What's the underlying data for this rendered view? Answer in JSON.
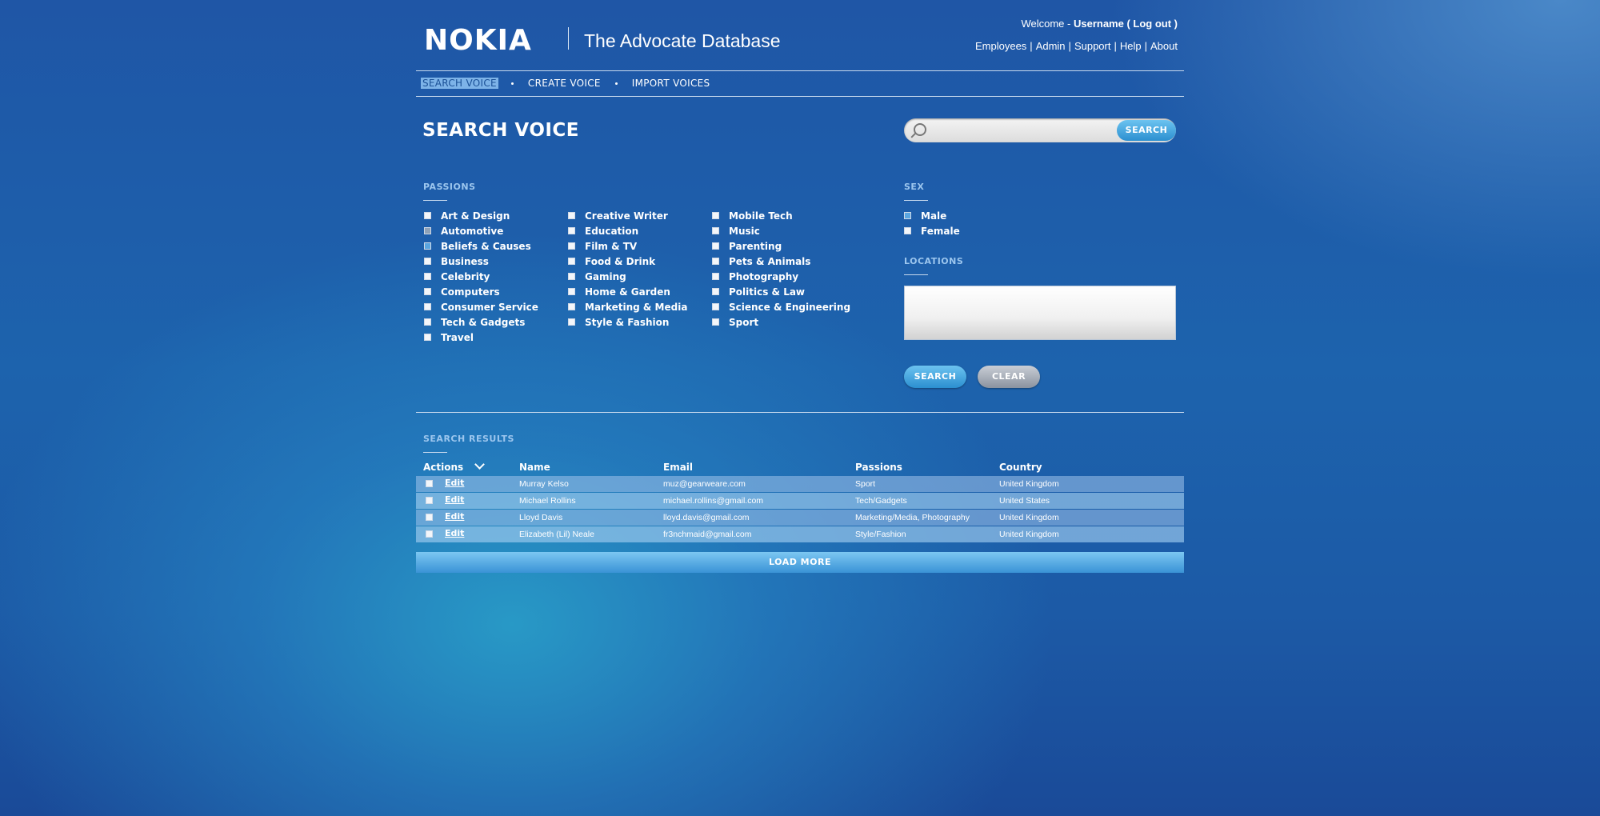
{
  "header": {
    "logo_text": "NOKIA",
    "app_title": "The Advocate Database",
    "welcome_prefix": "Welcome - ",
    "username": "Username",
    "logout": "( Log out )",
    "links": [
      "Employees",
      "Admin",
      "Support",
      "Help",
      "About"
    ]
  },
  "nav": {
    "items": [
      "SEARCH VOICE",
      "CREATE VOICE",
      "IMPORT VOICES"
    ],
    "active_index": 0
  },
  "page_title": "SEARCH VOICE",
  "search": {
    "placeholder": "",
    "button_label": "SEARCH"
  },
  "passions": {
    "label": "PASSIONS",
    "columns": [
      [
        {
          "label": "Art & Design",
          "state": "unchecked"
        },
        {
          "label": "Automotive",
          "state": "mid"
        },
        {
          "label": "Beliefs & Causes",
          "state": "checked"
        },
        {
          "label": "Business",
          "state": "unchecked"
        },
        {
          "label": "Celebrity",
          "state": "unchecked"
        },
        {
          "label": "Computers",
          "state": "unchecked"
        },
        {
          "label": "Consumer Service",
          "state": "unchecked"
        },
        {
          "label": "Tech & Gadgets",
          "state": "unchecked"
        },
        {
          "label": "Travel",
          "state": "unchecked"
        }
      ],
      [
        {
          "label": "Creative Writer",
          "state": "unchecked"
        },
        {
          "label": "Education",
          "state": "unchecked"
        },
        {
          "label": "Film & TV",
          "state": "unchecked"
        },
        {
          "label": "Food & Drink",
          "state": "unchecked"
        },
        {
          "label": "Gaming",
          "state": "unchecked"
        },
        {
          "label": "Home & Garden",
          "state": "unchecked"
        },
        {
          "label": "Marketing & Media",
          "state": "unchecked"
        },
        {
          "label": "Style & Fashion",
          "state": "unchecked"
        }
      ],
      [
        {
          "label": "Mobile Tech",
          "state": "unchecked"
        },
        {
          "label": "Music",
          "state": "unchecked"
        },
        {
          "label": "Parenting",
          "state": "unchecked"
        },
        {
          "label": "Pets & Animals",
          "state": "unchecked"
        },
        {
          "label": "Photography",
          "state": "unchecked"
        },
        {
          "label": "Politics & Law",
          "state": "unchecked"
        },
        {
          "label": "Science & Engineering",
          "state": "unchecked"
        },
        {
          "label": "Sport",
          "state": "unchecked"
        }
      ]
    ]
  },
  "sex": {
    "label": "SEX",
    "options": [
      {
        "label": "Male",
        "state": "checked"
      },
      {
        "label": "Female",
        "state": "unchecked"
      }
    ]
  },
  "locations": {
    "label": "LOCATIONS",
    "value": ""
  },
  "buttons": {
    "search": "SEARCH",
    "clear": "CLEAR"
  },
  "results": {
    "label": "SEARCH RESULTS",
    "columns": [
      "Actions",
      "Name",
      "Email",
      "Passions",
      "Country"
    ],
    "edit_label": "Edit",
    "rows": [
      {
        "name": "Murray Kelso",
        "email": "muz@gearweare.com",
        "passions": "Sport",
        "country": "United Kingdom"
      },
      {
        "name": "Michael Rollins",
        "email": "michael.rollins@gmail.com",
        "passions": "Tech/Gadgets",
        "country": "United States"
      },
      {
        "name": "Lloyd Davis",
        "email": "lloyd.davis@gmail.com",
        "passions": "Marketing/Media, Photography",
        "country": "United Kingdom"
      },
      {
        "name": "Elizabeth (Lil) Neale",
        "email": "fr3nchmaid@gmail.com",
        "passions": "Style/Fashion",
        "country": "United Kingdom"
      }
    ],
    "load_more": "LOAD MORE"
  }
}
